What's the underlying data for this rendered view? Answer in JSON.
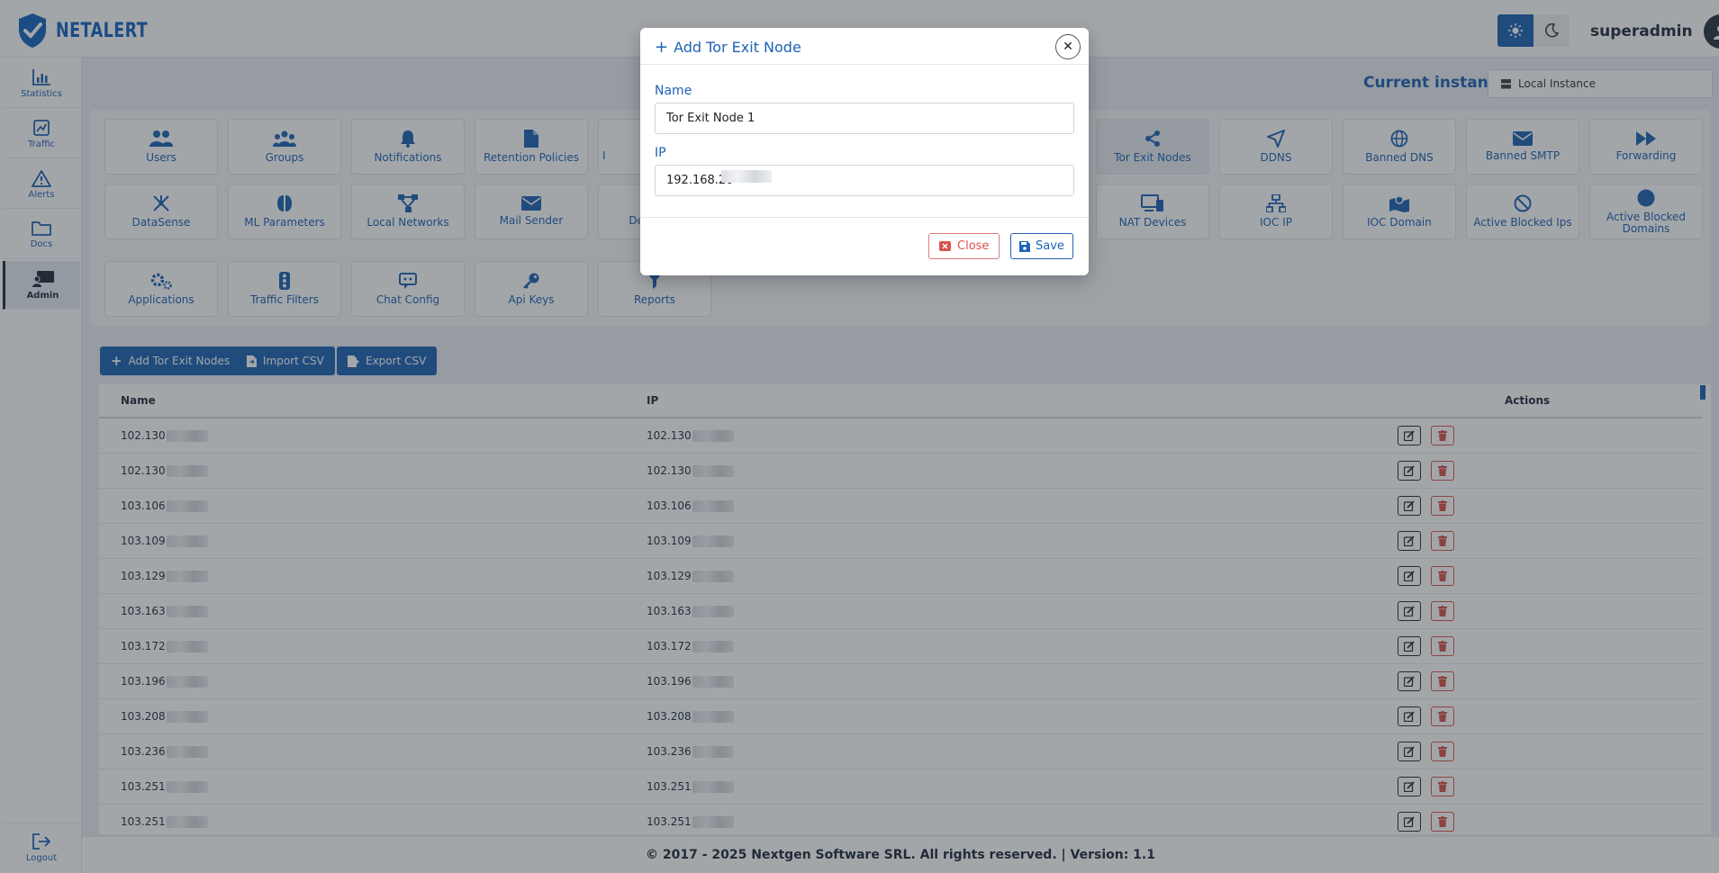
{
  "brand": {
    "name": "NETALERT"
  },
  "topbar": {
    "username": "superadmin"
  },
  "sidebar": {
    "items": [
      {
        "label": "Statistics",
        "icon": "bar-chart-icon"
      },
      {
        "label": "Traffic",
        "icon": "traffic-icon"
      },
      {
        "label": "Alerts",
        "icon": "warning-icon"
      },
      {
        "label": "Docs",
        "icon": "folder-icon"
      },
      {
        "label": "Admin",
        "icon": "admin-icon",
        "active": true
      }
    ],
    "logout": "Logout"
  },
  "instance": {
    "label": "Current instance:",
    "value": "Local Instance"
  },
  "tiles": [
    {
      "label": "Users"
    },
    {
      "label": "Groups"
    },
    {
      "label": "Notifications"
    },
    {
      "label": "Retention Policies"
    },
    {
      "label": "Tor Exit Nodes"
    },
    {
      "label": "DDNS"
    },
    {
      "label": "Banned DNS"
    },
    {
      "label": "Banned SMTP"
    },
    {
      "label": "Forwarding"
    },
    {
      "label": "DataSense"
    },
    {
      "label": "ML Parameters"
    },
    {
      "label": "Local Networks"
    },
    {
      "label": "Mail Sender"
    },
    {
      "label": "NAT Devices"
    },
    {
      "label": "IOC IP"
    },
    {
      "label": "IOC Domain"
    },
    {
      "label": "Active Blocked Ips"
    },
    {
      "label": "Active Blocked Domains"
    },
    {
      "label": "Applications"
    },
    {
      "label": "Traffic Filters"
    },
    {
      "label": "Chat Config"
    },
    {
      "label": "Api Keys"
    },
    {
      "label": "Reports"
    }
  ],
  "partial_tiles": {
    "row1": "I",
    "row2": "Dete"
  },
  "actions": {
    "add": "Add Tor Exit Nodes",
    "import": "Import CSV",
    "export": "Export CSV"
  },
  "table": {
    "columns": [
      "Name",
      "IP",
      "Actions"
    ],
    "rows": [
      {
        "name": "102.130",
        "ip": "102.130"
      },
      {
        "name": "102.130",
        "ip": "102.130"
      },
      {
        "name": "103.106",
        "ip": "103.106"
      },
      {
        "name": "103.109",
        "ip": "103.109"
      },
      {
        "name": "103.129",
        "ip": "103.129"
      },
      {
        "name": "103.163",
        "ip": "103.163"
      },
      {
        "name": "103.172",
        "ip": "103.172"
      },
      {
        "name": "103.196",
        "ip": "103.196"
      },
      {
        "name": "103.208",
        "ip": "103.208"
      },
      {
        "name": "103.236",
        "ip": "103.236"
      },
      {
        "name": "103.251",
        "ip": "103.251"
      },
      {
        "name": "103.251",
        "ip": "103.251"
      }
    ]
  },
  "footer": {
    "text": "© 2017 - 2025 Nextgen Software SRL. All rights reserved. | Version: 1.1"
  },
  "modal": {
    "title": "Add Tor Exit Node",
    "name_label": "Name",
    "name_value": "Tor Exit Node 1",
    "ip_label": "IP",
    "ip_value": "192.168.20",
    "close_label": "Close",
    "save_label": "Save"
  },
  "colors": {
    "accent": "#1e63b4",
    "danger": "#d9534f",
    "dark": "#1f2d3d"
  }
}
